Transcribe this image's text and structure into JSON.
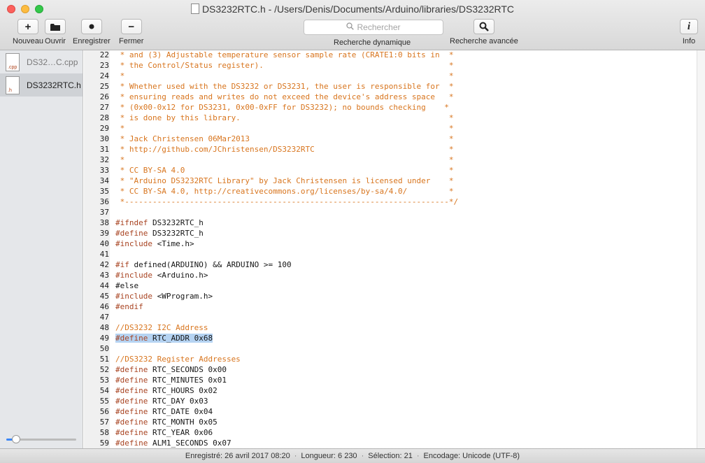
{
  "window": {
    "title": "DS3232RTC.h - /Users/Denis/Documents/Arduino/libraries/DS3232RTC"
  },
  "toolbar": {
    "new_label": "Nouveau",
    "open_label": "Ouvrir",
    "save_label": "Enregistrer",
    "close_label": "Fermer",
    "search_placeholder": "Rechercher",
    "dynamic_search_label": "Recherche dynamique",
    "advanced_search_label": "Recherche avancée",
    "info_label": "Info"
  },
  "sidebar": {
    "files": [
      {
        "name": "DS32…C.cpp",
        "ext": ".cpp",
        "selected": false
      },
      {
        "name": "DS3232RTC.h",
        "ext": ".h",
        "selected": true
      }
    ]
  },
  "editor": {
    "lines": [
      {
        "n": "22",
        "t": " * and (3) Adjustable temperature sensor sample rate (CRATE1:0 bits in  *",
        "kind": "comment"
      },
      {
        "n": "23",
        "t": " * the Control/Status register).                                        *",
        "kind": "comment"
      },
      {
        "n": "24",
        "t": " *                                                                      *",
        "kind": "comment"
      },
      {
        "n": "25",
        "t": " * Whether used with the DS3232 or DS3231, the user is responsible for  *",
        "kind": "comment"
      },
      {
        "n": "26",
        "t": " * ensuring reads and writes do not exceed the device's address space   *",
        "kind": "comment"
      },
      {
        "n": "27",
        "t": " * (0x00-0x12 for DS3231, 0x00-0xFF for DS3232); no bounds checking    *",
        "kind": "comment"
      },
      {
        "n": "28",
        "t": " * is done by this library.                                             *",
        "kind": "comment"
      },
      {
        "n": "29",
        "t": " *                                                                      *",
        "kind": "comment"
      },
      {
        "n": "30",
        "t": " * Jack Christensen 06Mar2013                                           *",
        "kind": "comment"
      },
      {
        "n": "31",
        "t": " * http://github.com/JChristensen/DS3232RTC                             *",
        "kind": "comment"
      },
      {
        "n": "32",
        "t": " *                                                                      *",
        "kind": "comment"
      },
      {
        "n": "33",
        "t": " * CC BY-SA 4.0                                                         *",
        "kind": "comment"
      },
      {
        "n": "34",
        "t": " * \"Arduino DS3232RTC Library\" by Jack Christensen is licensed under    *",
        "kind": "comment"
      },
      {
        "n": "35",
        "t": " * CC BY-SA 4.0, http://creativecommons.org/licenses/by-sa/4.0/         *",
        "kind": "comment"
      },
      {
        "n": "36",
        "t": " *----------------------------------------------------------------------*/",
        "kind": "comment"
      },
      {
        "n": "37",
        "kw": "",
        "t": "",
        "kind": "code"
      },
      {
        "n": "38",
        "kw": "#ifndef",
        "t": " DS3232RTC_h",
        "kind": "code"
      },
      {
        "n": "39",
        "kw": "#define",
        "t": " DS3232RTC_h",
        "kind": "code"
      },
      {
        "n": "40",
        "kw": "#include",
        "t": " <Time.h>",
        "kind": "code"
      },
      {
        "n": "41",
        "kw": "",
        "t": "",
        "kind": "code"
      },
      {
        "n": "42",
        "kw": "#if",
        "t": " defined(ARDUINO) && ARDUINO >= 100",
        "kind": "code"
      },
      {
        "n": "43",
        "kw": "#include",
        "t": " <Arduino.h>",
        "kind": "code"
      },
      {
        "n": "44",
        "kw": "",
        "t": "#else",
        "kind": "code"
      },
      {
        "n": "45",
        "kw": "#include",
        "t": " <WProgram.h>",
        "kind": "code"
      },
      {
        "n": "46",
        "kw": "#endif",
        "t": "",
        "kind": "code"
      },
      {
        "n": "47",
        "kw": "",
        "t": "",
        "kind": "code"
      },
      {
        "n": "48",
        "t": "//DS3232 I2C Address",
        "kind": "comment"
      },
      {
        "n": "49",
        "kw": "#define",
        "t": " RTC_ADDR 0x68",
        "kind": "code",
        "highlight": true
      },
      {
        "n": "50",
        "kw": "",
        "t": "",
        "kind": "code"
      },
      {
        "n": "51",
        "t": "//DS3232 Register Addresses",
        "kind": "comment"
      },
      {
        "n": "52",
        "kw": "#define",
        "t": " RTC_SECONDS 0x00",
        "kind": "code"
      },
      {
        "n": "53",
        "kw": "#define",
        "t": " RTC_MINUTES 0x01",
        "kind": "code"
      },
      {
        "n": "54",
        "kw": "#define",
        "t": " RTC_HOURS 0x02",
        "kind": "code"
      },
      {
        "n": "55",
        "kw": "#define",
        "t": " RTC_DAY 0x03",
        "kind": "code"
      },
      {
        "n": "56",
        "kw": "#define",
        "t": " RTC_DATE 0x04",
        "kind": "code"
      },
      {
        "n": "57",
        "kw": "#define",
        "t": " RTC_MONTH 0x05",
        "kind": "code"
      },
      {
        "n": "58",
        "kw": "#define",
        "t": " RTC_YEAR 0x06",
        "kind": "code"
      },
      {
        "n": "59",
        "kw": "#define",
        "t": " ALM1_SECONDS 0x07",
        "kind": "code"
      }
    ]
  },
  "status": {
    "saved": "Enregistré: 26 avril 2017 08:20",
    "length": "Longueur: 6 230",
    "selection": "Sélection: 21",
    "encoding": "Encodage: Unicode (UTF-8)",
    "separator": "·"
  },
  "sidebar_zoom": 0.1
}
